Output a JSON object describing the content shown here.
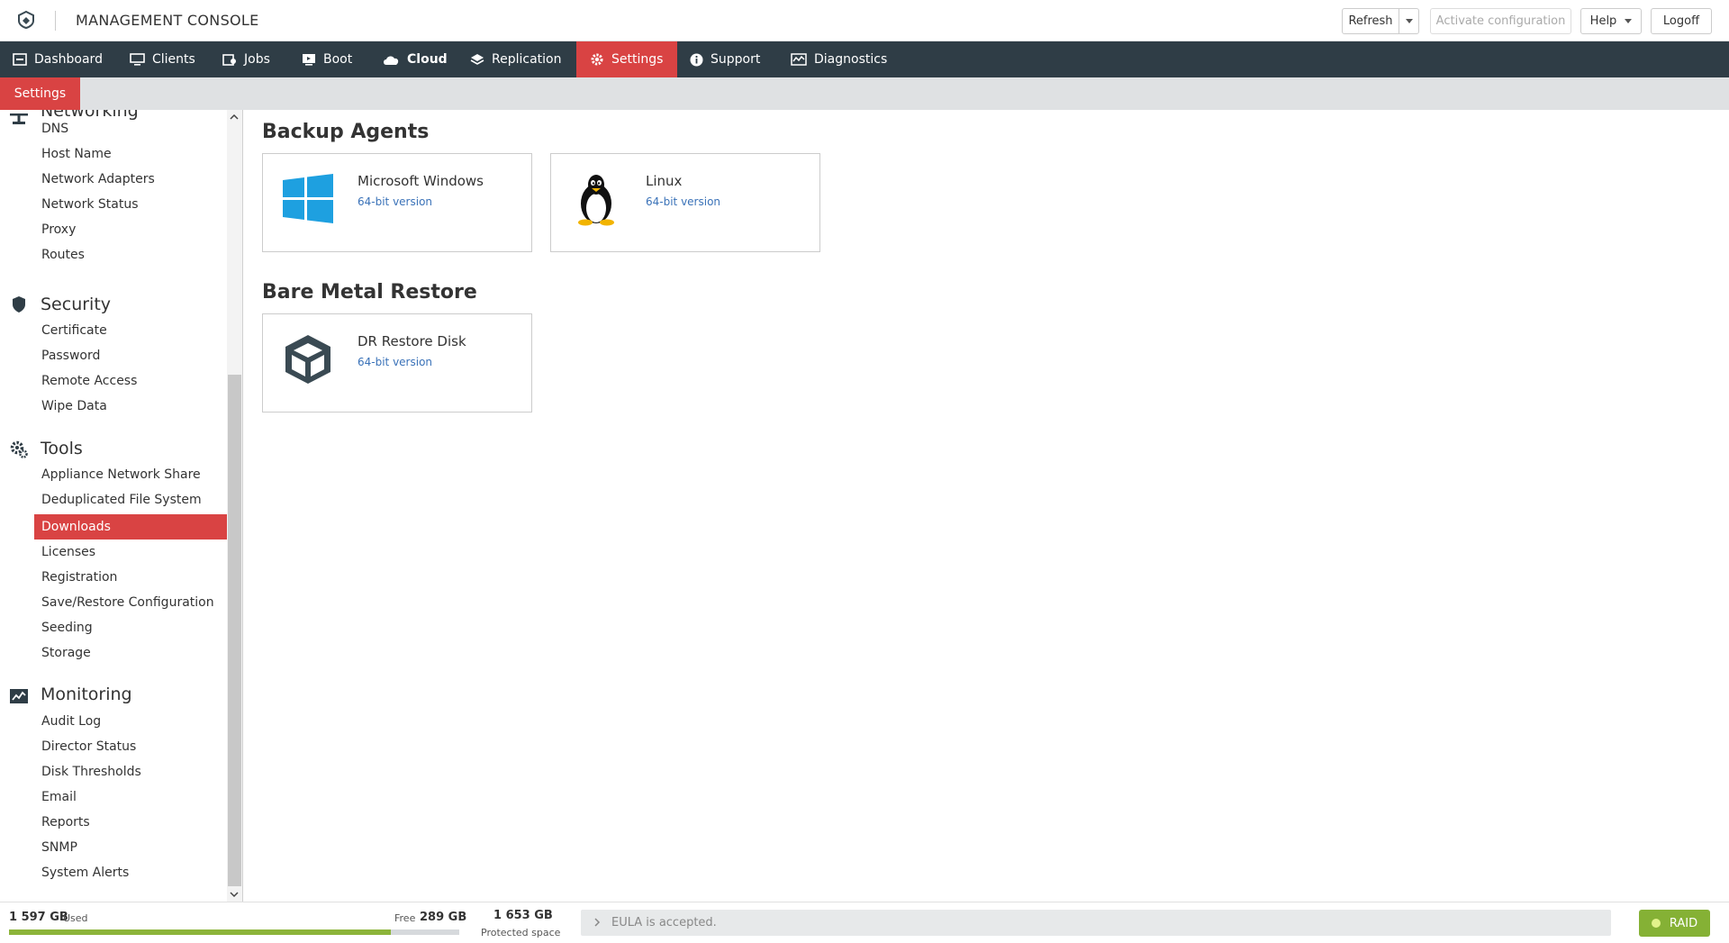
{
  "header": {
    "title": "MANAGEMENT CONSOLE",
    "refresh_label": "Refresh",
    "activate_label": "Activate configuration",
    "help_label": "Help",
    "logoff_label": "Logoff"
  },
  "nav": {
    "items": [
      {
        "label": "Dashboard",
        "icon": "dashboard-icon"
      },
      {
        "label": "Clients",
        "icon": "monitor-icon"
      },
      {
        "label": "Jobs",
        "icon": "jobs-icon"
      },
      {
        "label": "Boot",
        "icon": "boot-icon"
      },
      {
        "label": "Cloud",
        "icon": "cloud-icon"
      },
      {
        "label": "Replication",
        "icon": "replication-icon"
      },
      {
        "label": "Settings",
        "icon": "gear-icon",
        "active": true
      },
      {
        "label": "Support",
        "icon": "info-icon"
      },
      {
        "label": "Diagnostics",
        "icon": "diagnostics-icon"
      }
    ]
  },
  "subbar": {
    "tab_label": "Settings"
  },
  "sidebar": {
    "networking": {
      "title": "Networking",
      "items": [
        "DNS",
        "Host Name",
        "Network Adapters",
        "Network Status",
        "Proxy",
        "Routes"
      ]
    },
    "security": {
      "title": "Security",
      "items": [
        "Certificate",
        "Password",
        "Remote Access",
        "Wipe Data"
      ]
    },
    "tools": {
      "title": "Tools",
      "items": [
        "Appliance Network Share",
        "Deduplicated File System",
        "Downloads",
        "Licenses",
        "Registration",
        "Save/Restore Configuration",
        "Seeding",
        "Storage"
      ],
      "active": "Downloads"
    },
    "monitoring": {
      "title": "Monitoring",
      "items": [
        "Audit Log",
        "Director Status",
        "Disk Thresholds",
        "Email",
        "Reports",
        "SNMP",
        "System Alerts"
      ]
    }
  },
  "main": {
    "backup_agents": {
      "heading": "Backup Agents",
      "cards": [
        {
          "title": "Microsoft Windows",
          "link": "64-bit version",
          "icon": "windows-icon"
        },
        {
          "title": "Linux",
          "link": "64-bit version",
          "icon": "linux-penguin-icon"
        }
      ]
    },
    "bare_metal": {
      "heading": "Bare Metal Restore",
      "cards": [
        {
          "title": "DR Restore Disk",
          "link": "64-bit version",
          "icon": "box-icon"
        }
      ]
    }
  },
  "footer": {
    "used_value": "1 597 GB",
    "used_label": "Used",
    "free_label": "Free",
    "free_value": "289 GB",
    "used_fraction": 0.847,
    "protected_value": "1 653 GB",
    "protected_label": "Protected space",
    "eula_text": "EULA is accepted.",
    "raid_label": "RAID",
    "raid_color": "#85b135"
  },
  "colors": {
    "accent": "#d94343",
    "nav_bg": "#2f3d46",
    "link": "#3a72b8"
  }
}
